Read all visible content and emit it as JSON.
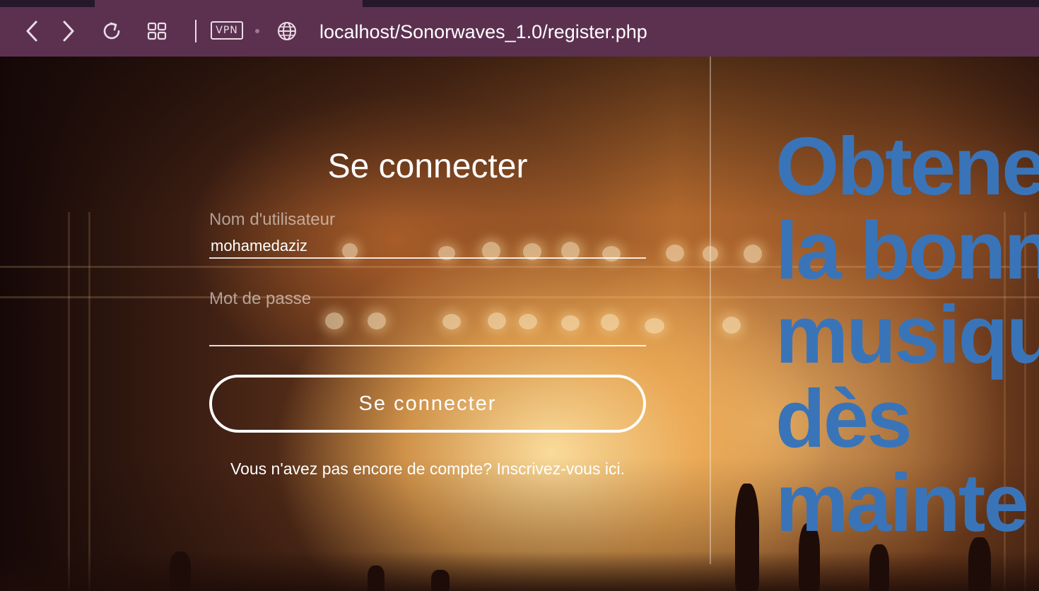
{
  "browser": {
    "url": "localhost/Sonorwaves_1.0/register.php",
    "vpn_label": "VPN",
    "icons": {
      "back": "chevron-left-icon",
      "forward": "chevron-right-icon",
      "reload": "reload-icon",
      "tabs": "grid-icon",
      "site": "globe-icon"
    },
    "colors": {
      "toolbar": "#5c3150",
      "tabstrip": "#24182a"
    }
  },
  "login": {
    "title": "Se connecter",
    "username_label": "Nom d'utilisateur",
    "username_value": "mohamedaziz",
    "password_label": "Mot de passe",
    "password_value": "",
    "submit_label": "Se connecter",
    "register_prompt": "Vous n'avez pas encore de compte?",
    "register_link": "Inscrivez-vous ici."
  },
  "hero": {
    "lines": [
      "Obtene",
      "la bonn",
      "musiqu",
      "dès",
      "mainte"
    ],
    "color": "#3a74b8"
  }
}
